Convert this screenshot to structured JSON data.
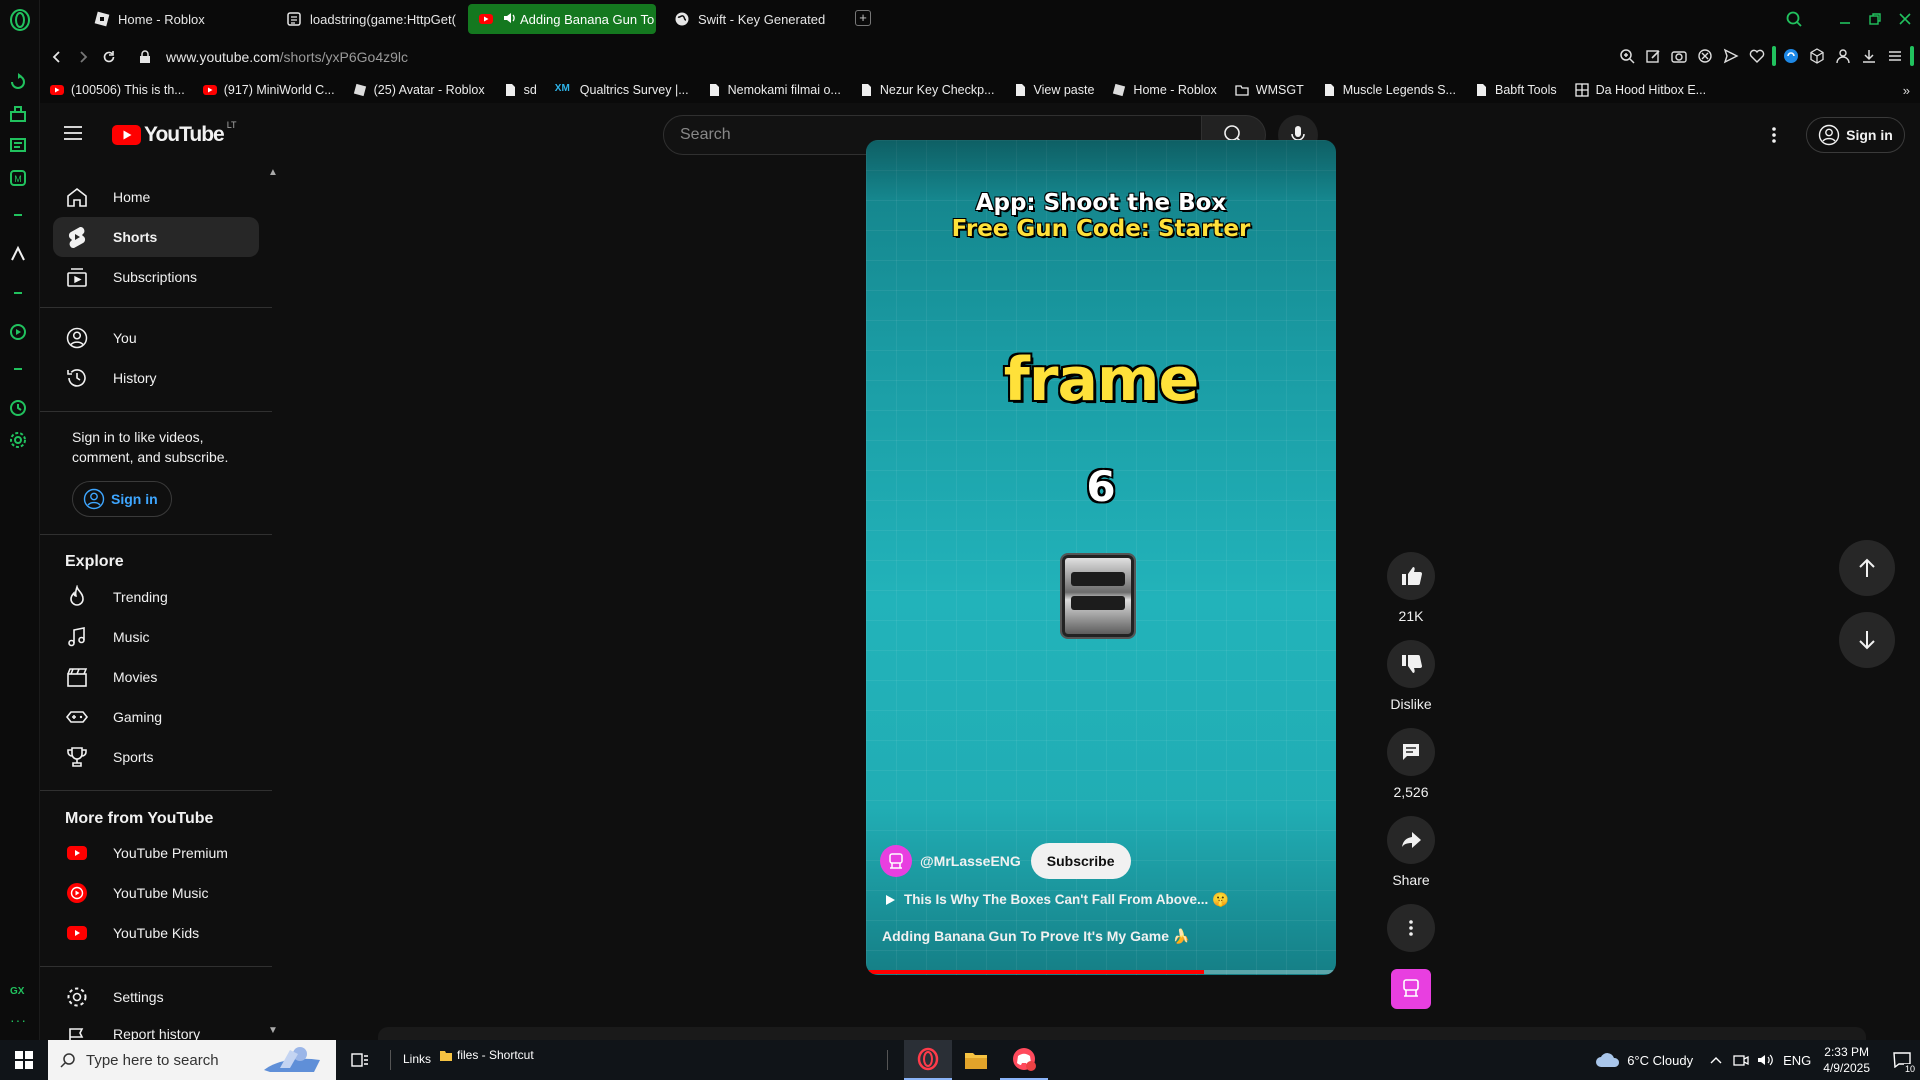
{
  "browser": {
    "tabs": [
      {
        "label": "Home - Roblox",
        "active": false
      },
      {
        "label": "loadstring(game:HttpGet(",
        "active": false
      },
      {
        "label": "Adding Banana Gun To",
        "active": true
      },
      {
        "label": "Swift - Key Generated",
        "active": false
      }
    ],
    "url_host": "www.youtube.com",
    "url_path": "/shorts/yxP6Go4z9lc",
    "bookmarks": [
      "(100506) This is th...",
      "(917) MiniWorld C...",
      "(25) Avatar - Roblox",
      "sd",
      "Qualtrics Survey |...",
      "Nemokami filmai o...",
      "Nezur Key Checkp...",
      "View paste",
      "Home - Roblox",
      "WMSGT",
      "Muscle Legends S...",
      "Babft Tools",
      "Da Hood Hitbox E..."
    ],
    "gx_label": "GX",
    "accent": "#21c25e"
  },
  "youtube": {
    "logo_text": "YouTube",
    "region": "LT",
    "search_placeholder": "Search",
    "sign_in": "Sign in",
    "sidebar": {
      "main": [
        "Home",
        "Shorts",
        "Subscriptions"
      ],
      "you": [
        "You",
        "History"
      ],
      "signin_prompt": "Sign in to like videos, comment, and subscribe.",
      "signin_button": "Sign in",
      "explore_title": "Explore",
      "explore": [
        "Trending",
        "Music",
        "Movies",
        "Gaming",
        "Sports"
      ],
      "more_title": "More from YouTube",
      "more": [
        "YouTube Premium",
        "YouTube Music",
        "YouTube Kids"
      ],
      "bottom": [
        "Settings",
        "Report history"
      ]
    },
    "short": {
      "overlay_line1": "App: Shoot the Box",
      "overlay_line2": "Free Gun Code: Starter",
      "overlay_big": "frame",
      "overlay_number": "6",
      "channel": "@MrLasseENG",
      "subscribe": "Subscribe",
      "playlist": "This Is Why The Boxes Can't Fall From Above... 🤫",
      "description": "Adding Banana Gun To Prove It's My Game 🍌",
      "progress": 0.72,
      "likes": "21K",
      "dislike": "Dislike",
      "comments": "2,526",
      "share": "Share"
    }
  },
  "taskbar": {
    "search_placeholder": "Type here to search",
    "links": "Links",
    "shortcut": "files - Shortcut",
    "weather": "6°C  Cloudy",
    "lang": "ENG",
    "time": "2:33 PM",
    "date": "4/9/2025",
    "notif_count": "10"
  }
}
